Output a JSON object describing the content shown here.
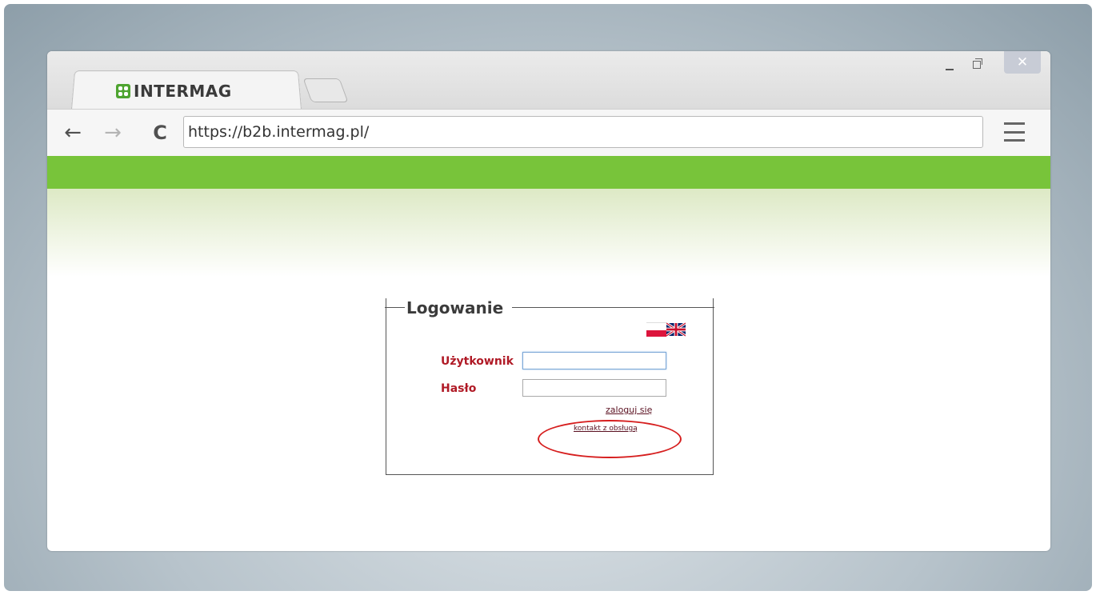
{
  "browser": {
    "tab_title": "INTERMAG",
    "url": "https://b2b.intermag.pl/",
    "close_glyph": "✕",
    "back_glyph": "←",
    "forward_glyph": "→",
    "reload_glyph": "C"
  },
  "login": {
    "legend": "Logowanie",
    "user_label": "Użytkownik",
    "password_label": "Hasło",
    "user_value": "",
    "password_value": "",
    "login_link": "zaloguj się",
    "contact_link": "kontakt z obsługą"
  },
  "languages": [
    "pl-flag-icon",
    "uk-flag-icon"
  ],
  "colors": {
    "green_band": "#78c43a",
    "label_red": "#b01a26",
    "annotation_red": "#d61e1e",
    "brand_green": "#4ea430"
  }
}
